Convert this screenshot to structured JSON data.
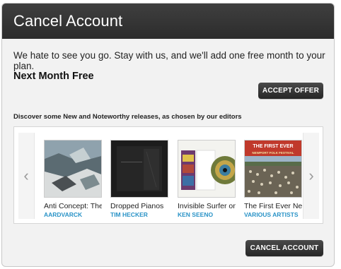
{
  "dialog": {
    "title": "Cancel Account",
    "intro": "We hate to see you go. Stay with us, and we'll add one free month to your plan.",
    "offer_title": "Next Month Free",
    "accept_label": "ACCEPT OFFER",
    "cancel_label": "CANCEL ACCOUNT"
  },
  "discover": {
    "heading": "Discover some New and Noteworthy releases, as chosen by our editors",
    "albums": [
      {
        "title": "Anti Concept: The",
        "artist": "AARDVARCK"
      },
      {
        "title": "Dropped Pianos",
        "artist": "TIM HECKER"
      },
      {
        "title": "Invisible Surfer on",
        "artist": "KEN SEENO"
      },
      {
        "title": "The First Ever Ne",
        "artist": "VARIOUS ARTISTS"
      }
    ],
    "cover_texts": {
      "first_ever": "THE FIRST EVER",
      "newport": "NEWPORT FOLK FESTIVAL"
    }
  },
  "colors": {
    "header_bg": "#333333",
    "artist_link": "#2a93c7",
    "button_bg": "#333333"
  },
  "icons": {
    "prev": "chevron-left-icon",
    "next": "chevron-right-icon"
  }
}
